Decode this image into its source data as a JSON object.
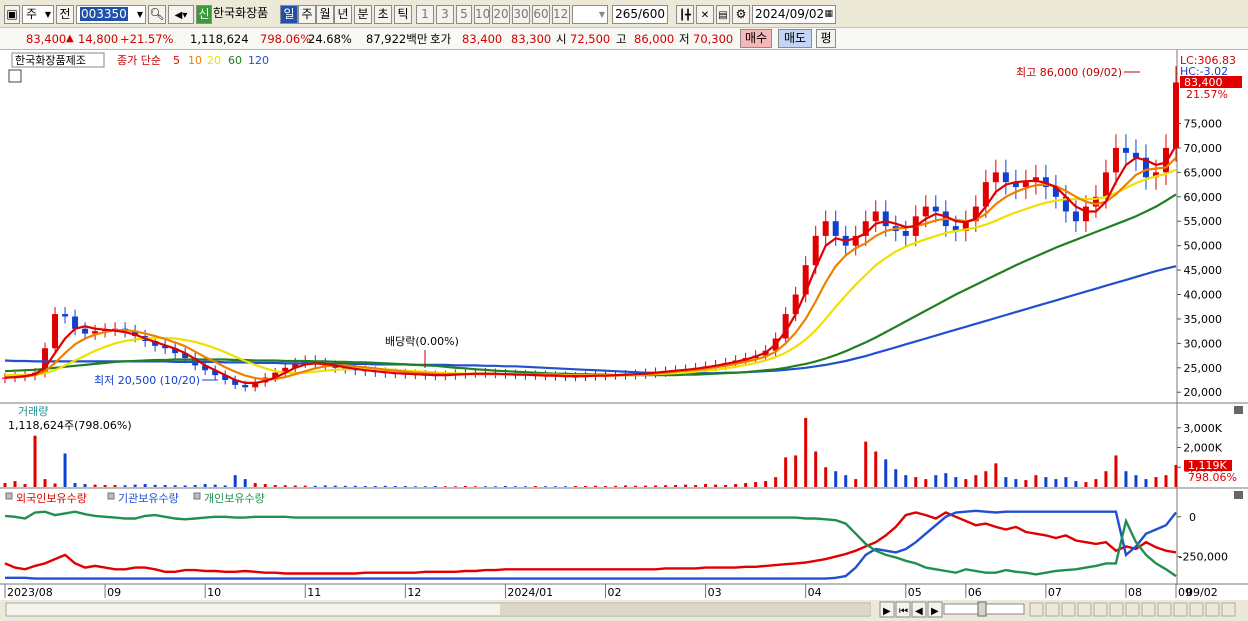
{
  "toolbar": {
    "market": "주",
    "prev": "전",
    "code": "003350",
    "new_badge": "신",
    "name": "한국화장품",
    "periods": [
      "일",
      "주",
      "월",
      "년",
      "분",
      "초",
      "틱"
    ],
    "active_period": "일",
    "intervals": [
      "1",
      "3",
      "5",
      "10",
      "20",
      "30",
      "60",
      "120"
    ],
    "count": "265",
    "count_total": "/600",
    "date": "2024/09/02"
  },
  "quote": {
    "price": "83,400",
    "change_arrow": "▲",
    "change": "14,800",
    "change_pct": "+21.57%",
    "volume": "1,118,624",
    "volume_ratio": "798.06%",
    "turnover": "24.68%",
    "amount": "87,922백만",
    "bid_label": "호가",
    "ask": "83,400",
    "bid": "83,300",
    "open_label": "시",
    "open": "72,500",
    "high_label": "고",
    "high": "86,000",
    "low_label": "저",
    "low": "70,300",
    "buy": "매수",
    "sell": "매도",
    "flat": "평"
  },
  "chart_data": {
    "type": "candlestick",
    "title": "한국화장품제조",
    "legend": {
      "label": "종가 단순",
      "periods": [
        "5",
        "10",
        "20",
        "60",
        "120"
      ],
      "colors": [
        "#e00000",
        "#f08000",
        "#f0e000",
        "#208020",
        "#2050d0"
      ]
    },
    "x_ticks": [
      "2023/08",
      "09",
      "10",
      "11",
      "12",
      "2024/01",
      "02",
      "03",
      "04",
      "05",
      "06",
      "07",
      "08",
      "09"
    ],
    "right_date": "09/02",
    "y_ticks": [
      "75,000",
      "70,000",
      "65,000",
      "60,000",
      "55,000",
      "50,000",
      "45,000",
      "40,000",
      "35,000",
      "30,000",
      "25,000",
      "20,000"
    ],
    "ylim": [
      18000,
      88000
    ],
    "lc": "LC:306.83",
    "hc": "HC:-3.02",
    "last_price": "83,400",
    "last_pct": "21.57%",
    "high_note": "최고 86,000 (09/02)",
    "low_note": "최저 20,500 (10/20)",
    "div_note": "배당락(0.00%)",
    "closes": [
      23000,
      23200,
      23400,
      24000,
      29000,
      36000,
      35500,
      33000,
      32000,
      32500,
      32800,
      33000,
      32500,
      31500,
      30500,
      29500,
      29000,
      28000,
      27000,
      25500,
      24500,
      23500,
      22500,
      21500,
      21000,
      22000,
      23000,
      24000,
      25000,
      26000,
      26500,
      26000,
      25500,
      25000,
      24800,
      24500,
      24300,
      24100,
      23900,
      23800,
      23700,
      23600,
      23500,
      23400,
      23500,
      23700,
      23900,
      24000,
      23900,
      23800,
      23700,
      23600,
      23500,
      23500,
      23400,
      23300,
      23200,
      23200,
      23300,
      23400,
      23500,
      23500,
      23600,
      23700,
      23900,
      24100,
      24300,
      24500,
      24700,
      25000,
      25300,
      25600,
      26000,
      26500,
      27000,
      27500,
      28500,
      31000,
      36000,
      40000,
      46000,
      52000,
      55000,
      52000,
      50000,
      52000,
      55000,
      57000,
      54000,
      53000,
      52000,
      56000,
      58000,
      57000,
      54000,
      53000,
      55000,
      58000,
      63000,
      65000,
      63000,
      62000,
      63000,
      64000,
      62000,
      60000,
      57000,
      55000,
      58000,
      60000,
      65000,
      70000,
      69000,
      68000,
      64000,
      65000,
      70000,
      83400
    ],
    "ma5": [
      23000,
      23100,
      23300,
      23700,
      25000,
      28000,
      31000,
      33000,
      33500,
      33000,
      32800,
      32600,
      32300,
      31800,
      31000,
      30300,
      29600,
      28900,
      28000,
      26800,
      25500,
      24500,
      23500,
      22500,
      21900,
      21900,
      22300,
      23000,
      24000,
      25000,
      25700,
      25900,
      25800,
      25500,
      25100,
      24800,
      24500,
      24300,
      24100,
      23900,
      23800,
      23700,
      23600,
      23500,
      23500,
      23600,
      23700,
      23800,
      23800,
      23800,
      23700,
      23600,
      23600,
      23500,
      23400,
      23400,
      23300,
      23300,
      23300,
      23400,
      23400,
      23500,
      23600,
      23700,
      23800,
      24000,
      24200,
      24400,
      24600,
      24800,
      25100,
      25400,
      25800,
      26200,
      26700,
      27300,
      28100,
      29800,
      32500,
      36000,
      40500,
      45500,
      50000,
      51500,
      51000,
      51500,
      52500,
      54500,
      55000,
      54500,
      53800,
      54000,
      55500,
      56500,
      56000,
      55000,
      54800,
      55500,
      58000,
      61000,
      62500,
      63000,
      63200,
      63300,
      62800,
      62000,
      60000,
      58000,
      57000,
      57000,
      59000,
      63000,
      66500,
      68000,
      67500,
      66500,
      67000,
      70500
    ],
    "ma10": [
      23000,
      23050,
      23200,
      23500,
      24300,
      26000,
      28000,
      29800,
      31000,
      31800,
      32300,
      32700,
      32700,
      32500,
      32000,
      31500,
      30900,
      30200,
      29400,
      28300,
      27200,
      26200,
      25100,
      24200,
      23400,
      22900,
      22600,
      22700,
      23100,
      23700,
      24300,
      24900,
      25300,
      25500,
      25500,
      25300,
      25100,
      24900,
      24600,
      24400,
      24200,
      24000,
      23900,
      23800,
      23700,
      23700,
      23700,
      23700,
      23700,
      23700,
      23700,
      23700,
      23600,
      23600,
      23500,
      23500,
      23400,
      23400,
      23400,
      23400,
      23400,
      23400,
      23500,
      23600,
      23700,
      23800,
      24000,
      24200,
      24400,
      24600,
      24800,
      25100,
      25400,
      25800,
      26200,
      26700,
      27300,
      28300,
      30000,
      32200,
      35000,
      38600,
      42500,
      45800,
      48000,
      49500,
      50500,
      52000,
      53000,
      53500,
      53700,
      54000,
      54500,
      55200,
      55500,
      55300,
      55000,
      55300,
      56500,
      58500,
      60000,
      61000,
      61800,
      62400,
      62500,
      62200,
      61200,
      60000,
      59000,
      58500,
      59000,
      60500,
      62500,
      64500,
      65500,
      65800,
      66000,
      68000
    ],
    "ma20": [
      23500,
      23500,
      23500,
      23600,
      23900,
      24500,
      25500,
      26500,
      27500,
      28500,
      29300,
      30000,
      30500,
      30800,
      31000,
      31100,
      31100,
      31000,
      30700,
      30300,
      29700,
      29000,
      28200,
      27300,
      26400,
      25600,
      24900,
      24300,
      24000,
      23900,
      24000,
      24200,
      24400,
      24600,
      24700,
      24800,
      24800,
      24800,
      24700,
      24600,
      24400,
      24300,
      24200,
      24000,
      23900,
      23900,
      23800,
      23800,
      23800,
      23700,
      23700,
      23700,
      23700,
      23600,
      23600,
      23600,
      23500,
      23500,
      23500,
      23500,
      23500,
      23500,
      23500,
      23500,
      23600,
      23700,
      23800,
      23900,
      24000,
      24200,
      24400,
      24600,
      24900,
      25200,
      25600,
      26000,
      26500,
      27200,
      28100,
      29300,
      30800,
      32700,
      35000,
      37500,
      39800,
      42000,
      44000,
      46000,
      47500,
      48800,
      49800,
      50600,
      51300,
      52000,
      52600,
      53000,
      53300,
      53700,
      54300,
      55100,
      56000,
      56800,
      57500,
      58200,
      58800,
      59200,
      59500,
      59500,
      59500,
      59600,
      60000,
      60800,
      61800,
      62800,
      63600,
      64200,
      64700,
      65500
    ],
    "ma60": [
      24300,
      24400,
      24500,
      24600,
      24800,
      25000,
      25200,
      25400,
      25600,
      25800,
      26000,
      26200,
      26300,
      26400,
      26500,
      26600,
      26600,
      26700,
      26700,
      26700,
      26700,
      26700,
      26700,
      26600,
      26600,
      26500,
      26500,
      26500,
      26400,
      26400,
      26400,
      26300,
      26300,
      26200,
      26200,
      26100,
      26100,
      26000,
      25900,
      25800,
      25700,
      25600,
      25500,
      25400,
      25200,
      25000,
      24900,
      24700,
      24600,
      24400,
      24300,
      24200,
      24100,
      24000,
      23900,
      23800,
      23800,
      23700,
      23700,
      23600,
      23600,
      23500,
      23500,
      23500,
      23500,
      23500,
      23500,
      23500,
      23600,
      23600,
      23700,
      23800,
      23900,
      24000,
      24100,
      24300,
      24500,
      24700,
      25000,
      25400,
      25800,
      26300,
      26900,
      27600,
      28400,
      29300,
      30200,
      31200,
      32300,
      33400,
      34500,
      35600,
      36700,
      37800,
      38900,
      40000,
      41000,
      42000,
      43000,
      44000,
      45000,
      46000,
      46900,
      47800,
      48700,
      49600,
      50400,
      51200,
      52000,
      52800,
      53600,
      54400,
      55200,
      56000,
      57000,
      58000,
      59200,
      60500
    ],
    "ma120": [
      26500,
      26400,
      26400,
      26300,
      26300,
      26300,
      26300,
      26300,
      26300,
      26300,
      26300,
      26300,
      26300,
      26300,
      26300,
      26300,
      26300,
      26200,
      26200,
      26200,
      26200,
      26200,
      26100,
      26100,
      26100,
      26000,
      26000,
      26000,
      25900,
      25900,
      25900,
      25900,
      25800,
      25800,
      25800,
      25800,
      25800,
      25700,
      25700,
      25700,
      25700,
      25600,
      25600,
      25600,
      25600,
      25500,
      25500,
      25500,
      25400,
      25400,
      25300,
      25300,
      25200,
      25100,
      25000,
      24900,
      24800,
      24700,
      24600,
      24500,
      24400,
      24300,
      24200,
      24100,
      24000,
      24000,
      23900,
      23900,
      23900,
      23900,
      23900,
      23900,
      24000,
      24000,
      24100,
      24200,
      24300,
      24400,
      24600,
      24800,
      25000,
      25300,
      25600,
      26000,
      26400,
      26900,
      27400,
      28000,
      28600,
      29200,
      29800,
      30400,
      31000,
      31600,
      32200,
      32800,
      33400,
      34000,
      34600,
      35200,
      35800,
      36400,
      37000,
      37600,
      38200,
      38800,
      39400,
      40000,
      40600,
      41200,
      41800,
      42400,
      43000,
      43600,
      44200,
      44800,
      45300,
      45800
    ]
  },
  "volume_panel": {
    "title": "거래량",
    "info": "1,118,624주(798.06%)",
    "y_ticks": [
      "3,000K",
      "2,000K",
      "1,000K"
    ],
    "last": "1,119K",
    "last_pct": "798.06%",
    "values": [
      200,
      300,
      150,
      2600,
      400,
      180,
      1700,
      200,
      150,
      120,
      100,
      100,
      90,
      120,
      150,
      110,
      100,
      90,
      80,
      100,
      150,
      120,
      80,
      600,
      400,
      200,
      150,
      100,
      90,
      80,
      70,
      60,
      80,
      70,
      60,
      60,
      50,
      50,
      60,
      50,
      50,
      40,
      40,
      50,
      40,
      40,
      50,
      40,
      40,
      40,
      50,
      40,
      40,
      50,
      40,
      40,
      40,
      50,
      50,
      60,
      50,
      60,
      80,
      60,
      70,
      80,
      90,
      100,
      120,
      100,
      150,
      120,
      100,
      150,
      200,
      250,
      300,
      500,
      1500,
      1600,
      3500,
      1800,
      1000,
      800,
      600,
      400,
      2300,
      1800,
      1400,
      900,
      600,
      500,
      400,
      600,
      700,
      500,
      400,
      600,
      800,
      1200,
      500,
      400,
      350,
      600,
      500,
      400,
      500,
      300,
      250,
      400,
      800,
      1600,
      800,
      600,
      400,
      500,
      600,
      1119
    ],
    "vmax": 3800
  },
  "holdings_panel": {
    "labels": [
      "외국인보유수량",
      "기관보유수량",
      "개인보유수량"
    ],
    "colors": [
      "#e00000",
      "#2050d0",
      "#209050"
    ],
    "y_ticks": [
      "0",
      "-250,000"
    ],
    "foreign": [
      -0.55,
      -0.6,
      -0.62,
      -0.58,
      -0.55,
      -0.5,
      -0.45,
      -0.55,
      -0.6,
      -0.58,
      -0.6,
      -0.62,
      -0.62,
      -0.6,
      -0.6,
      -0.62,
      -0.65,
      -0.65,
      -0.63,
      -0.63,
      -0.64,
      -0.64,
      -0.65,
      -0.65,
      -0.64,
      -0.65,
      -0.66,
      -0.66,
      -0.67,
      -0.67,
      -0.67,
      -0.67,
      -0.67,
      -0.67,
      -0.67,
      -0.67,
      -0.66,
      -0.66,
      -0.66,
      -0.66,
      -0.66,
      -0.66,
      -0.65,
      -0.65,
      -0.65,
      -0.65,
      -0.64,
      -0.64,
      -0.63,
      -0.63,
      -0.62,
      -0.62,
      -0.62,
      -0.62,
      -0.62,
      -0.62,
      -0.62,
      -0.62,
      -0.62,
      -0.62,
      -0.62,
      -0.62,
      -0.62,
      -0.62,
      -0.62,
      -0.62,
      -0.61,
      -0.61,
      -0.61,
      -0.61,
      -0.6,
      -0.6,
      -0.6,
      -0.6,
      -0.59,
      -0.59,
      -0.58,
      -0.57,
      -0.56,
      -0.55,
      -0.54,
      -0.52,
      -0.5,
      -0.47,
      -0.44,
      -0.4,
      -0.35,
      -0.3,
      -0.22,
      -0.12,
      0.02,
      0.05,
      0.02,
      -0.02,
      0.05,
      0.0,
      -0.05,
      -0.1,
      -0.08,
      -0.12,
      -0.15,
      -0.12,
      -0.18,
      -0.2,
      -0.22,
      -0.25,
      -0.22,
      -0.28,
      -0.3,
      -0.32,
      -0.3,
      -0.4,
      -0.35,
      -0.38,
      -0.3,
      -0.36,
      -0.4,
      -0.42
    ],
    "inst": [
      -0.72,
      -0.72,
      -0.72,
      -0.73,
      -0.73,
      -0.73,
      -0.73,
      -0.73,
      -0.73,
      -0.73,
      -0.73,
      -0.73,
      -0.73,
      -0.73,
      -0.73,
      -0.73,
      -0.73,
      -0.73,
      -0.73,
      -0.73,
      -0.73,
      -0.73,
      -0.73,
      -0.73,
      -0.73,
      -0.73,
      -0.73,
      -0.73,
      -0.73,
      -0.73,
      -0.73,
      -0.73,
      -0.73,
      -0.73,
      -0.73,
      -0.73,
      -0.73,
      -0.73,
      -0.73,
      -0.73,
      -0.73,
      -0.73,
      -0.73,
      -0.73,
      -0.73,
      -0.73,
      -0.73,
      -0.73,
      -0.73,
      -0.73,
      -0.73,
      -0.73,
      -0.73,
      -0.73,
      -0.73,
      -0.73,
      -0.73,
      -0.73,
      -0.73,
      -0.73,
      -0.73,
      -0.73,
      -0.73,
      -0.73,
      -0.73,
      -0.73,
      -0.73,
      -0.73,
      -0.73,
      -0.73,
      -0.73,
      -0.73,
      -0.73,
      -0.73,
      -0.73,
      -0.73,
      -0.73,
      -0.73,
      -0.73,
      -0.73,
      -0.73,
      -0.73,
      -0.73,
      -0.72,
      -0.7,
      -0.6,
      -0.45,
      -0.38,
      -0.4,
      -0.42,
      -0.38,
      -0.3,
      -0.2,
      -0.1,
      0.0,
      0.05,
      0.06,
      0.07,
      0.06,
      0.05,
      0.06,
      0.06,
      0.06,
      0.06,
      0.06,
      0.06,
      0.06,
      0.06,
      0.06,
      0.06,
      0.06,
      0.06,
      -0.45,
      -0.35,
      -0.2,
      -0.15,
      -0.1,
      0.05
    ],
    "indiv": [
      0.01,
      0.0,
      -0.02,
      0.05,
      0.06,
      0.02,
      0.04,
      0.06,
      0.03,
      0.01,
      0.0,
      -0.01,
      -0.02,
      -0.02,
      0.01,
      0.02,
      0.0,
      -0.02,
      -0.03,
      -0.02,
      -0.01,
      0.0,
      0.0,
      -0.01,
      -0.01,
      0.0,
      0.0,
      0.0,
      0.0,
      -0.01,
      -0.01,
      -0.01,
      -0.01,
      -0.01,
      -0.01,
      -0.01,
      -0.01,
      -0.01,
      -0.01,
      -0.01,
      -0.01,
      -0.01,
      -0.01,
      -0.01,
      -0.01,
      -0.01,
      -0.01,
      -0.01,
      -0.01,
      -0.01,
      -0.01,
      -0.01,
      -0.01,
      -0.01,
      -0.01,
      -0.01,
      -0.01,
      -0.01,
      -0.01,
      -0.01,
      -0.01,
      -0.01,
      -0.01,
      -0.01,
      -0.01,
      -0.01,
      -0.01,
      -0.01,
      -0.01,
      -0.01,
      -0.01,
      -0.01,
      -0.01,
      -0.01,
      -0.01,
      -0.01,
      -0.01,
      -0.01,
      -0.01,
      -0.01,
      -0.02,
      -0.02,
      -0.03,
      -0.04,
      -0.08,
      -0.2,
      -0.32,
      -0.4,
      -0.45,
      -0.48,
      -0.52,
      -0.55,
      -0.6,
      -0.62,
      -0.64,
      -0.66,
      -0.62,
      -0.64,
      -0.66,
      -0.66,
      -0.63,
      -0.65,
      -0.66,
      -0.68,
      -0.66,
      -0.64,
      -0.63,
      -0.62,
      -0.6,
      -0.58,
      -0.55,
      -0.55,
      -0.05,
      -0.3,
      -0.45,
      -0.55,
      -0.62,
      -0.7
    ]
  }
}
